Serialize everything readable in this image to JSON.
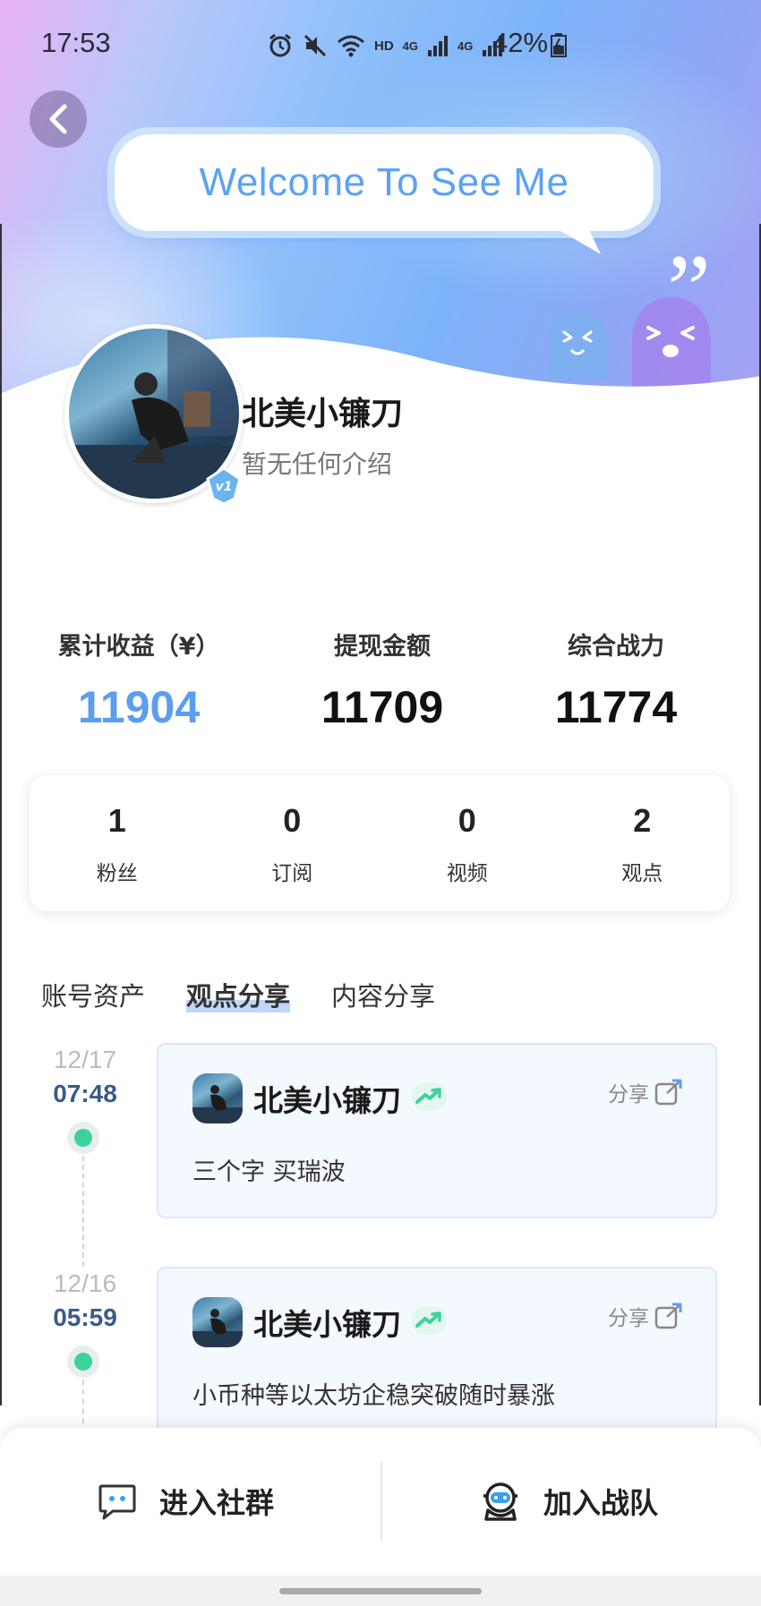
{
  "status_bar": {
    "time": "17:53",
    "hd": "HD",
    "network_1": "4G",
    "network_2": "4G",
    "battery": "42%"
  },
  "header": {
    "welcome_text": "Welcome To See Me",
    "back_icon": "chevron-left-icon"
  },
  "profile": {
    "name": "北美小镰刀",
    "bio": "暂无任何介绍",
    "level_badge": "v1"
  },
  "stats": [
    {
      "label": "累计收益（¥）",
      "value": "11904"
    },
    {
      "label": "提现金额",
      "value": "11709"
    },
    {
      "label": "综合战力",
      "value": "11774"
    }
  ],
  "counts": [
    {
      "num": "1",
      "label": "粉丝"
    },
    {
      "num": "0",
      "label": "订阅"
    },
    {
      "num": "0",
      "label": "视频"
    },
    {
      "num": "2",
      "label": "观点"
    }
  ],
  "tabs": [
    {
      "label": "账号资产",
      "active": false
    },
    {
      "label": "观点分享",
      "active": true
    },
    {
      "label": "内容分享",
      "active": false
    }
  ],
  "posts": [
    {
      "date": "12/17",
      "time": "07:48",
      "author": "北美小镰刀",
      "share_label": "分享",
      "content": "三个字 买瑞波"
    },
    {
      "date": "12/16",
      "time": "05:59",
      "author": "北美小镰刀",
      "share_label": "分享",
      "content": "小币种等以太坊企稳突破随时暴涨"
    }
  ],
  "bottom_bar": {
    "left_label": "进入社群",
    "right_label": "加入战队"
  },
  "colors": {
    "accent": "#5b9df0",
    "timeline_dot": "#3bd39a",
    "time_text": "#3a5a8a"
  }
}
